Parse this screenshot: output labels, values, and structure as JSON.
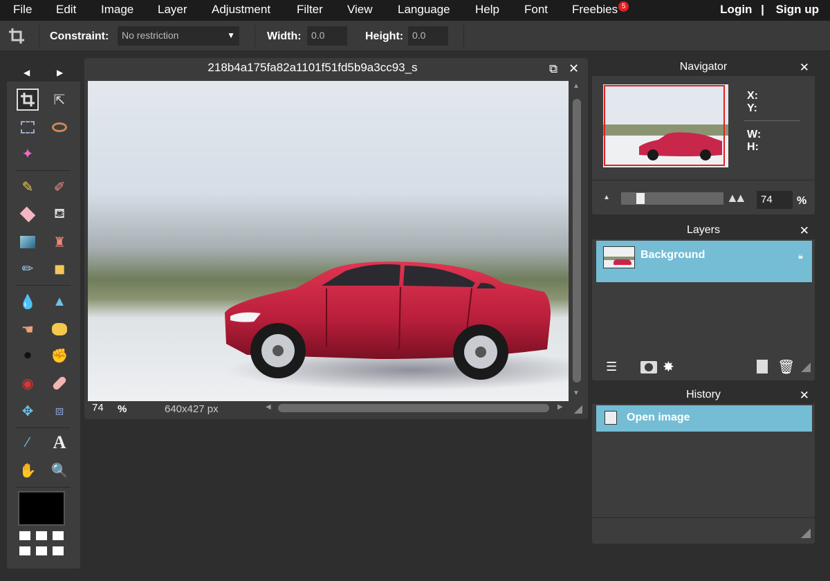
{
  "menu": {
    "items": [
      "File",
      "Edit",
      "Image",
      "Layer",
      "Adjustment",
      "Filter",
      "View",
      "Language",
      "Help",
      "Font",
      "Freebies"
    ],
    "freebies_badge": "5",
    "login": "Login",
    "divider": "|",
    "signup": "Sign up"
  },
  "options": {
    "constraint_label": "Constraint:",
    "constraint_value": "No restriction",
    "width_label": "Width:",
    "width_value": "0.0",
    "height_label": "Height:",
    "height_value": "0.0"
  },
  "document": {
    "title": "218b4a175fa82a1101f51fd5b9a3cc93_s",
    "zoom": "74",
    "zoom_unit": "%",
    "dimensions": "640x427 px"
  },
  "navigator": {
    "title": "Navigator",
    "x_label": "X:",
    "y_label": "Y:",
    "w_label": "W:",
    "h_label": "H:",
    "zoom": "74",
    "zoom_unit": "%"
  },
  "layers": {
    "title": "Layers",
    "items": [
      {
        "name": "Background",
        "locked": true
      }
    ]
  },
  "history": {
    "title": "History",
    "items": [
      {
        "label": "Open image"
      }
    ]
  },
  "colors": {
    "accent": "#74bdd4",
    "foreground": "#000000",
    "background": "#ffffff"
  }
}
